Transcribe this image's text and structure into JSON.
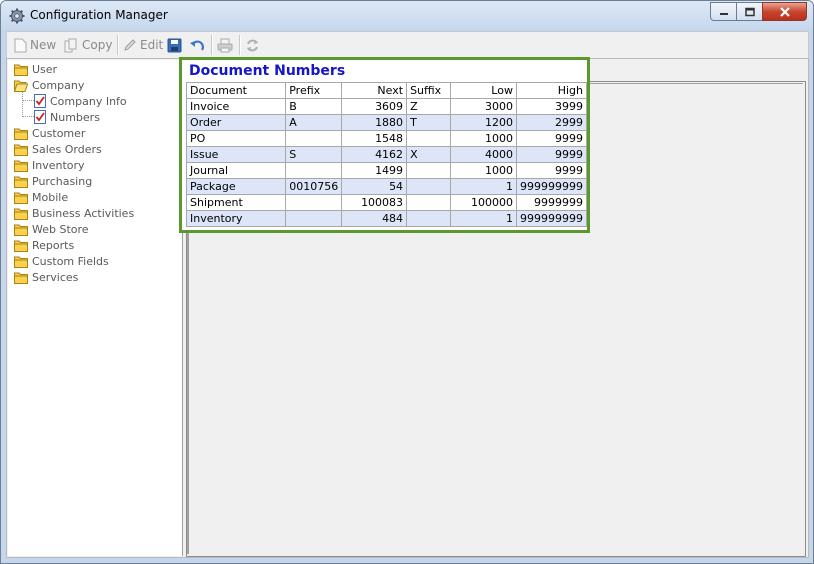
{
  "window": {
    "title": "Configuration Manager"
  },
  "toolbar": {
    "new_label": "New",
    "copy_label": "Copy",
    "edit_label": "Edit"
  },
  "tree": {
    "items": [
      {
        "label": "User"
      },
      {
        "label": "Company"
      },
      {
        "label": "Company Info"
      },
      {
        "label": "Numbers"
      },
      {
        "label": "Customer"
      },
      {
        "label": "Sales Orders"
      },
      {
        "label": "Inventory"
      },
      {
        "label": "Purchasing"
      },
      {
        "label": "Mobile"
      },
      {
        "label": "Business Activities"
      },
      {
        "label": "Web Store"
      },
      {
        "label": "Reports"
      },
      {
        "label": "Custom Fields"
      },
      {
        "label": "Services"
      }
    ]
  },
  "panel": {
    "title": "Document Numbers",
    "columns": [
      "Document",
      "Prefix",
      "Next",
      "Suffix",
      "Low",
      "High"
    ],
    "rows": [
      [
        "Invoice",
        "B",
        "3609",
        "Z",
        "3000",
        "3999"
      ],
      [
        "Order",
        "A",
        "1880",
        "T",
        "1200",
        "2999"
      ],
      [
        "PO",
        "",
        "1548",
        "",
        "1000",
        "9999"
      ],
      [
        "Issue",
        "S",
        "4162",
        "X",
        "4000",
        "9999"
      ],
      [
        "Journal",
        "",
        "1499",
        "",
        "1000",
        "9999"
      ],
      [
        "Package",
        "0010756",
        "54",
        "",
        "1",
        "999999999"
      ],
      [
        "Shipment",
        "",
        "100083",
        "",
        "100000",
        "9999999"
      ],
      [
        "Inventory",
        "",
        "484",
        "",
        "1",
        "999999999"
      ]
    ]
  },
  "colors": {
    "accent_border": "#5a9a2c",
    "title_text": "#1616c8",
    "alt_row": "#dde5f8"
  }
}
